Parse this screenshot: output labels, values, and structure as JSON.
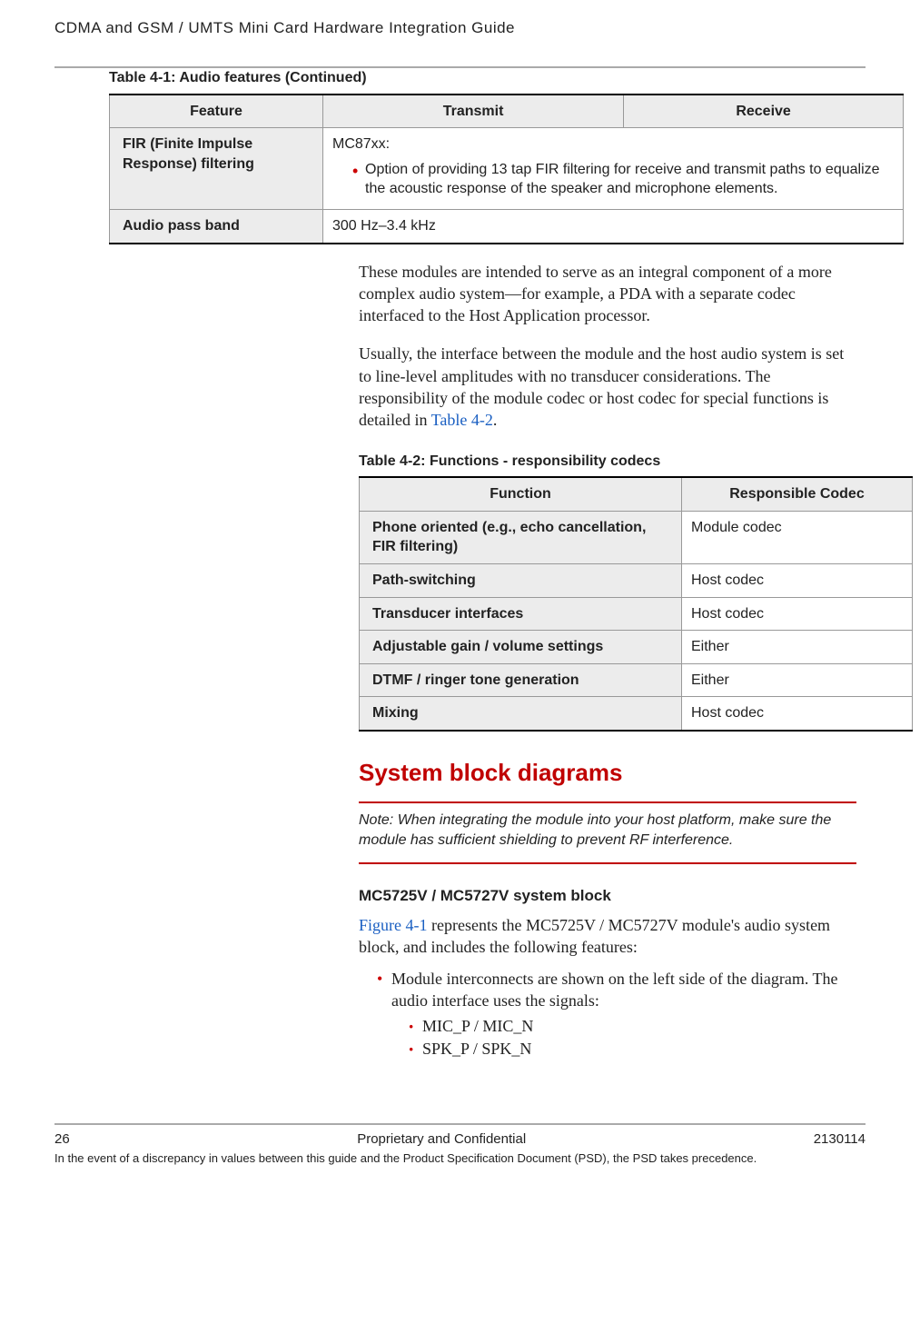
{
  "header": {
    "title": "CDMA and GSM / UMTS Mini Card Hardware Integration Guide"
  },
  "table41": {
    "title": "Table 4-1:  Audio features (Continued)",
    "columns": [
      "Feature",
      "Transmit",
      "Receive"
    ],
    "rows": [
      {
        "feature": "FIR (Finite Impulse Response) filtering",
        "line1": "MC87xx:",
        "bullet": "Option of providing 13 tap FIR filtering for receive and transmit paths to equalize the acoustic response of the speaker and microphone elements."
      },
      {
        "feature": "Audio pass band",
        "value": "300 Hz–3.4 kHz"
      }
    ]
  },
  "para1": "These modules are intended to serve as an integral component of a more complex audio system—for example, a PDA with a separate codec interfaced to the Host Application processor.",
  "para2_a": "Usually, the interface between the module and the host audio system is set to line-level amplitudes with no transducer considerations. The responsibility of the module codec or host codec for special functions is detailed in ",
  "para2_link": "Table 4-2",
  "para2_b": ".",
  "table42": {
    "title": "Table 4-2:  Functions - responsibility codecs",
    "columns": [
      "Function",
      "Responsible Codec"
    ],
    "rows": [
      {
        "function": "Phone oriented (e.g., echo cancellation, FIR filtering)",
        "codec": "Module codec"
      },
      {
        "function": "Path-switching",
        "codec": "Host codec"
      },
      {
        "function": "Transducer interfaces",
        "codec": "Host codec"
      },
      {
        "function": "Adjustable gain / volume settings",
        "codec": "Either"
      },
      {
        "function": "DTMF / ringer tone generation",
        "codec": "Either"
      },
      {
        "function": "Mixing",
        "codec": "Host codec"
      }
    ]
  },
  "section_heading": "System block diagrams",
  "note": "Note:  When integrating the module into your host platform, make sure the module has sufficient shielding to prevent RF interference.",
  "subsect_heading": "MC5725V / MC5727V system block",
  "fig_link": "Figure 4-1",
  "fig_text": " represents the MC5725V / MC5727V module's audio system block, and includes the following features:",
  "bullet_module": "Module interconnects are shown on the left side of the diagram. The audio interface uses the signals:",
  "signals": [
    "MIC_P / MIC_N",
    "SPK_P / SPK_N"
  ],
  "footer": {
    "left": "26",
    "center": "Proprietary and Confidential",
    "right": "2130114",
    "note": "In the event of a discrepancy in values between this guide and the Product Specification Document (PSD), the PSD takes precedence."
  }
}
